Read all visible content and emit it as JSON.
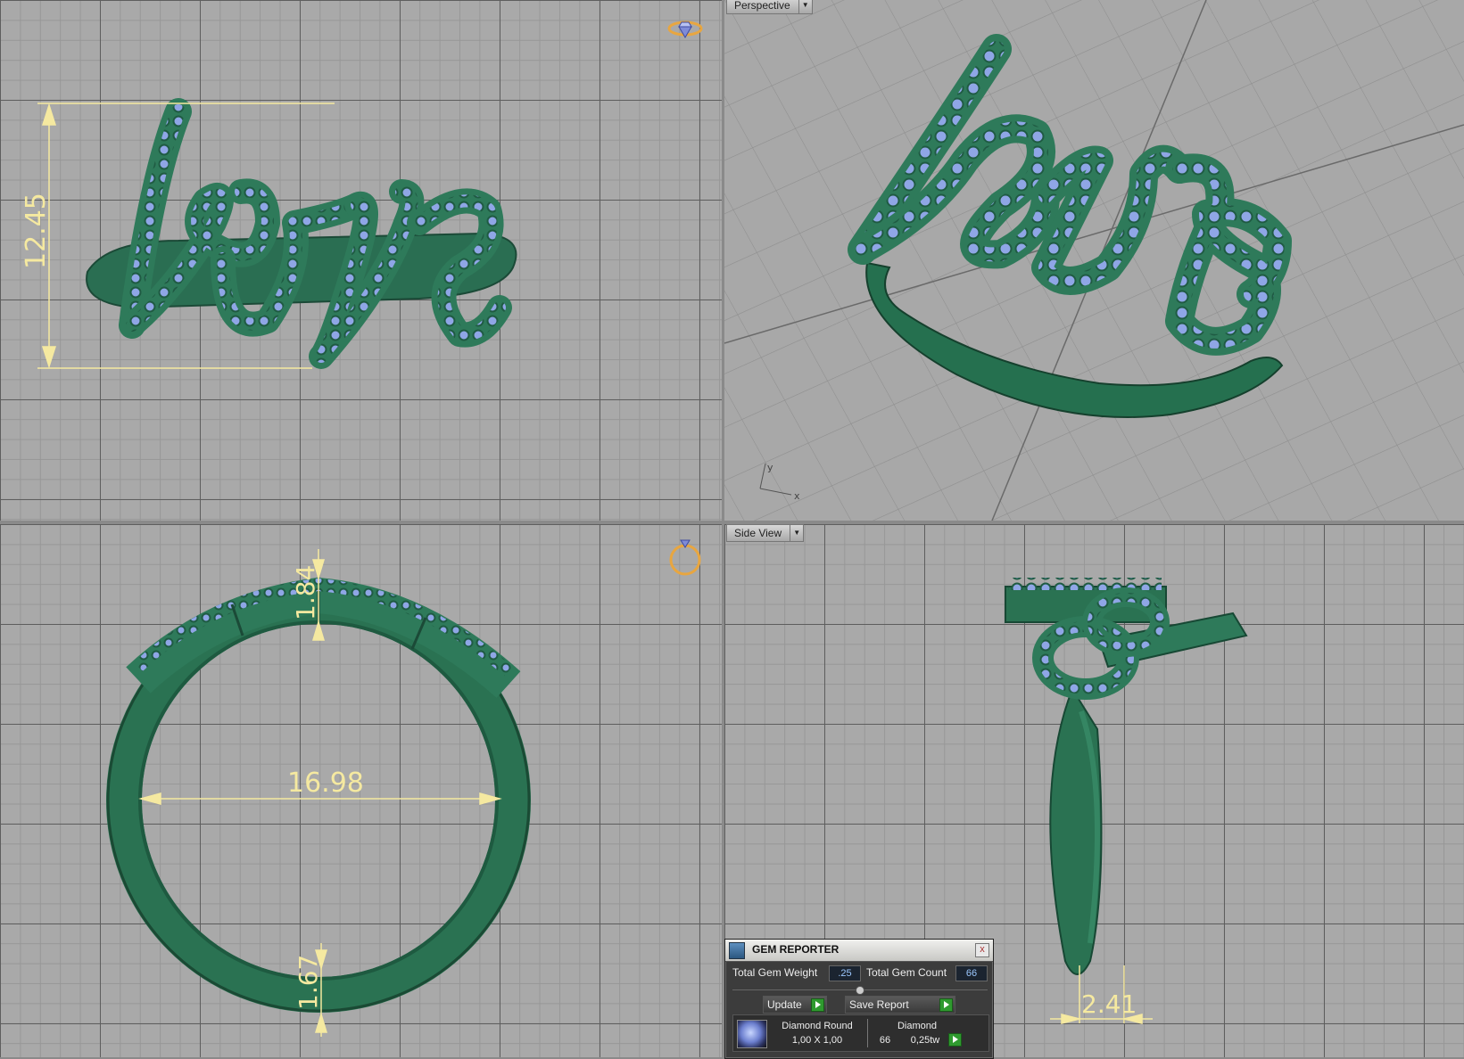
{
  "viewports": {
    "perspective_label": "Perspective",
    "side_label": "Side View"
  },
  "dimensions": {
    "height": "12.45",
    "thickness_top": "1.84",
    "inner_diameter": "16.98",
    "thickness_bottom": "1.67",
    "width": "2.41"
  },
  "axis_labels": {
    "y": "y",
    "x": "x"
  },
  "gem_reporter": {
    "title": "GEM REPORTER",
    "close_symbol": "x",
    "total_weight_label": "Total Gem Weight",
    "total_weight_value": ".25",
    "total_count_label": "Total Gem Count",
    "total_count_value": "66",
    "update_label": "Update",
    "save_report_label": "Save Report",
    "gem": {
      "shape": "Diamond Round",
      "size": "1,00 X 1,00",
      "material": "Diamond",
      "count": "66",
      "weight": "0,25tw"
    }
  },
  "colors": {
    "metal": "#2e7a5a",
    "stones": "#8fa6e6",
    "dimension": "#f5e9a0",
    "viewport_bg": "#a9a9a9"
  },
  "icons": [
    "diamond-ring-icon",
    "ring-icon",
    "gem-reporter-icon",
    "close-icon"
  ]
}
